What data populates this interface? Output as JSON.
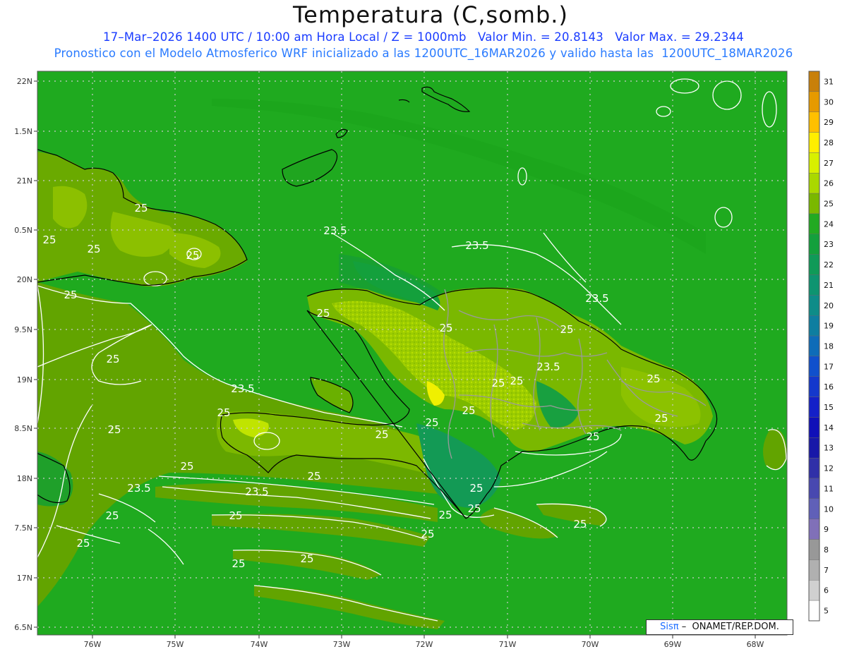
{
  "header": {
    "title": "Temperatura (C,somb.)",
    "subtitle_line1": "17–Mar–2026 1400 UTC / 10:00 am Hora Local / Z = 1000mb   Valor Min. = 20.8143   Valor Max. = 29.2344",
    "subtitle_line2": "Pronostico con el Modelo Atmosferico WRF inicializado a las 1200UTC_16MAR2026 y valido hasta las  1200UTC_18MAR2026"
  },
  "map": {
    "lat_ticks": [
      "22N",
      "1.5N",
      "21N",
      "0.5N",
      "20N",
      "9.5N",
      "19N",
      "8.5N",
      "18N",
      "7.5N",
      "17N",
      "6.5N"
    ],
    "lon_ticks": [
      "76W",
      "75W",
      "74W",
      "73W",
      "72W",
      "71W",
      "70W",
      "69W",
      "68W"
    ],
    "contour_labels": [
      "25",
      "25",
      "25",
      "25",
      "25",
      "23.5",
      "23.5",
      "23.5",
      "25",
      "25",
      "25",
      "23.5",
      "25",
      "25",
      "25",
      "25",
      "25",
      "25",
      "25",
      "25",
      "23.5",
      "25",
      "25",
      "25",
      "25",
      "25",
      "23.5",
      "23.5",
      "25",
      "25",
      "25",
      "25",
      "25",
      "25",
      "25",
      "25",
      "25",
      "25"
    ],
    "colors": {
      "ocean_23_24": "#1faa1f",
      "land_25": "#66a800",
      "land_26": "#8ec400",
      "land_27": "#b4e000",
      "cool_22": "#14a03c",
      "cool_21": "#139a55",
      "contour": "#ffffff",
      "coast": "#000000",
      "borders": "#999999"
    }
  },
  "colorbar": {
    "labels": [
      "31",
      "30",
      "29",
      "28",
      "27",
      "26",
      "25",
      "24",
      "23",
      "22",
      "21",
      "20",
      "19",
      "18",
      "17",
      "16",
      "15",
      "14",
      "13",
      "12",
      "11",
      "10",
      "9",
      "8",
      "7",
      "6",
      "5"
    ],
    "colors": [
      "#c8800a",
      "#e69a00",
      "#ffc000",
      "#ffee00",
      "#d8f000",
      "#aad800",
      "#7ab800",
      "#22aa22",
      "#14a03c",
      "#109a58",
      "#0e9470",
      "#0e8c88",
      "#0e7ea0",
      "#0e6cb8",
      "#1050cc",
      "#1438cc",
      "#1420c8",
      "#1010b8",
      "#1818a8",
      "#3030a8",
      "#4848b0",
      "#6060b8",
      "#8070b8",
      "#989898",
      "#b0b0b0",
      "#d0d0d0",
      "#ffffff"
    ]
  },
  "credit": {
    "sis": "Sisπ",
    "org": "–  ONAMET/REP.DOM."
  }
}
